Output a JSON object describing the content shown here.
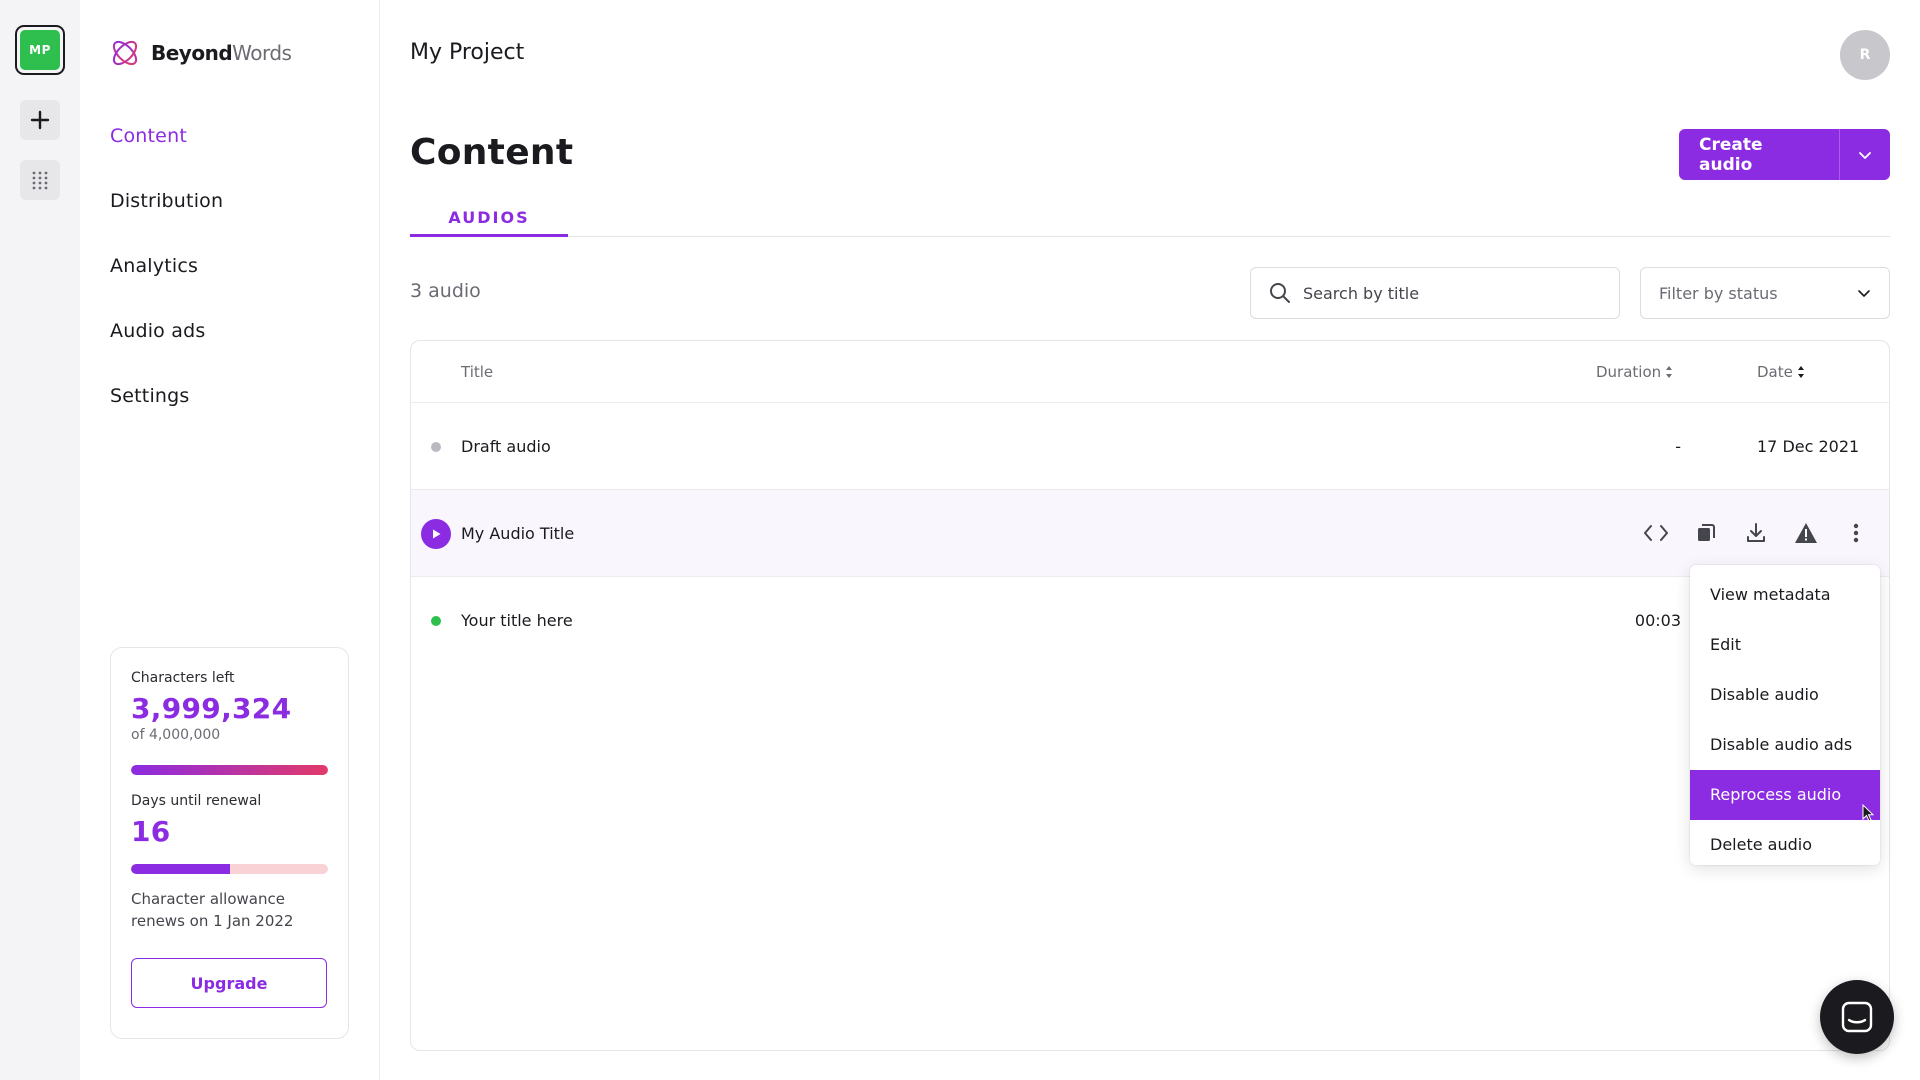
{
  "rail": {
    "project_badge": "MP",
    "project_color": "#2fbf4f"
  },
  "sidebar": {
    "logo": {
      "bold": "Beyond",
      "light": "Words"
    },
    "nav": [
      {
        "label": "Content",
        "active": true
      },
      {
        "label": "Distribution",
        "active": false
      },
      {
        "label": "Analytics",
        "active": false
      },
      {
        "label": "Audio ads",
        "active": false
      },
      {
        "label": "Settings",
        "active": false
      }
    ],
    "usage": {
      "chars_label": "Characters left",
      "chars_value": "3,999,324",
      "chars_total": "of 4,000,000",
      "chars_fraction": 0.9998,
      "days_label": "Days until renewal",
      "days_value": "16",
      "days_fraction": 0.5,
      "note": "Character allowance renews on 1 Jan 2022",
      "upgrade_label": "Upgrade"
    }
  },
  "header": {
    "project_title": "My Project",
    "avatar_initial": "R"
  },
  "main": {
    "page_title": "Content",
    "create_label": "Create audio",
    "tabs": [
      {
        "label": "AUDIOS",
        "active": true
      }
    ],
    "count_text": "3 audio",
    "search_placeholder": "Search by title",
    "filter_placeholder": "Filter by status",
    "table": {
      "columns": {
        "title": "Title",
        "duration": "Duration",
        "date": "Date"
      },
      "rows": [
        {
          "title": "Draft audio",
          "duration": "-",
          "date": "17 Dec 2021",
          "status": "draft",
          "status_color": "#b9b9c0"
        },
        {
          "title": "My Audio Title",
          "duration": "",
          "date": "",
          "status": "playable",
          "status_color": "#8b2be2"
        },
        {
          "title": "Your title here",
          "duration": "00:03",
          "date": "",
          "status": "ready",
          "status_color": "#2fbf4f"
        }
      ]
    },
    "row_actions": [
      "code-icon",
      "copy-icon",
      "download-icon",
      "warning-icon",
      "more-vertical-icon"
    ],
    "context_menu": [
      {
        "label": "View metadata",
        "active": false
      },
      {
        "label": "Edit",
        "active": false
      },
      {
        "label": "Disable audio",
        "active": false
      },
      {
        "label": "Disable audio ads",
        "active": false
      },
      {
        "label": "Reprocess audio",
        "active": true
      },
      {
        "label": "Delete audio",
        "active": false
      }
    ]
  },
  "colors": {
    "accent": "#8b2be2",
    "text": "#1b1b1f",
    "muted": "#6b6b74"
  }
}
